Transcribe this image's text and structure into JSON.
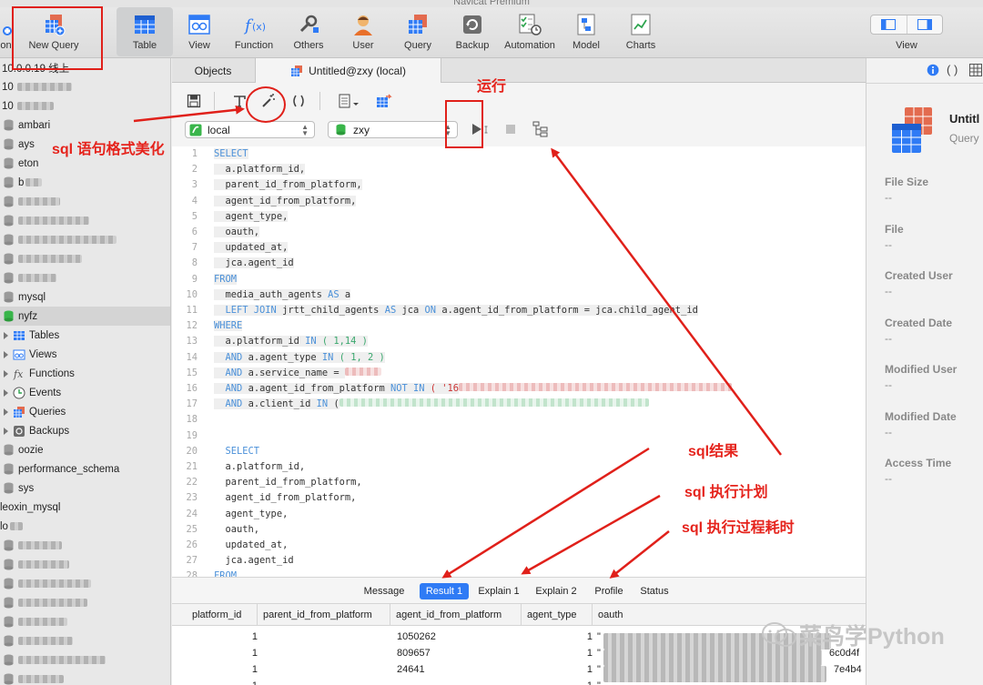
{
  "app": {
    "title": "Navicat Premium"
  },
  "toolbar": {
    "items": [
      {
        "label": "ction"
      },
      {
        "label": "New Query"
      },
      {
        "label": "Table"
      },
      {
        "label": "View"
      },
      {
        "label": "Function"
      },
      {
        "label": "Others"
      },
      {
        "label": "User"
      },
      {
        "label": "Query"
      },
      {
        "label": "Backup"
      },
      {
        "label": "Automation"
      },
      {
        "label": "Model"
      },
      {
        "label": "Charts"
      }
    ],
    "view_label": "View"
  },
  "sidebar": {
    "conn1": "10.0.0.19 线上",
    "conn2": "10",
    "conn3": "10",
    "dbs": [
      "ambari",
      "ays",
      "eton",
      "b",
      "mysql",
      "nyfz"
    ],
    "children": [
      "Tables",
      "Views",
      "Functions",
      "Events",
      "Queries",
      "Backups"
    ],
    "dbs_after": [
      "oozie",
      "performance_schema",
      "sys",
      "leoxin_mysql",
      "lo"
    ]
  },
  "tabs": {
    "objects": "Objects",
    "query": "Untitled@zxy (local)"
  },
  "query_toolbar": {
    "connection": "local",
    "database": "zxy"
  },
  "sql": {
    "select": "SELECT",
    "from": "FROM",
    "where": "WHERE",
    "c1": "a.platform_id,",
    "c2": "parent_id_from_platform,",
    "c3": "agent_id_from_platform,",
    "c4": "agent_type,",
    "c5": "oauth,",
    "c6": "updated_at,",
    "c7": "jca.agent_id",
    "f1a": "media_auth_agents",
    "as": "AS",
    "f1b": "a",
    "lj": "LEFT JOIN",
    "f2a": "jrtt_child_agents",
    "f2b": "jca",
    "on": "ON",
    "f2c": "a.agent_id_from_platform = jca.child_agent_id",
    "w1a": "a.platform_id",
    "in": "IN",
    "w1b": "( 1,14 )",
    "and": "AND",
    "w2a": "a.agent_type",
    "w2b": "( 1, 2 )",
    "w3a": "a.service_name =",
    "w4a": "a.agent_id_from_platform",
    "notin": "NOT IN",
    "w4b": "( '16",
    "w5a": "a.client_id",
    "w5b": "(",
    "line_numbers": [
      "1",
      "2",
      "3",
      "4",
      "5",
      "6",
      "7",
      "8",
      "9",
      "10",
      "11",
      "12",
      "13",
      "14",
      "15",
      "16",
      "17",
      "18",
      "19",
      "20",
      "21",
      "22",
      "23",
      "24",
      "25",
      "26",
      "27",
      "28"
    ]
  },
  "result_tabs": [
    "Message",
    "Result 1",
    "Explain 1",
    "Explain 2",
    "Profile",
    "Status"
  ],
  "grid": {
    "headers": [
      "platform_id",
      "parent_id_from_platform",
      "agent_id_from_platform",
      "agent_type",
      "oauth"
    ],
    "rows": [
      {
        "platform_id": "1",
        "agent_id": "1050262",
        "agent_type": "1",
        "oauth": "\"",
        "tail": ""
      },
      {
        "platform_id": "1",
        "agent_id": "809657",
        "agent_type": "1",
        "oauth": "\"",
        "tail": "6c0d4f"
      },
      {
        "platform_id": "1",
        "agent_id": "24641",
        "agent_type": "1",
        "oauth": "\"",
        "tail": "7e4b4"
      },
      {
        "platform_id": "1",
        "agent_id": "",
        "agent_type": "1",
        "oauth": "\"",
        "tail": ""
      }
    ]
  },
  "info": {
    "title": "Untitl",
    "subtitle": "Query",
    "fields": [
      {
        "label": "File Size",
        "value": "--"
      },
      {
        "label": "File",
        "value": "--"
      },
      {
        "label": "Created User",
        "value": "--"
      },
      {
        "label": "Created Date",
        "value": "--"
      },
      {
        "label": "Modified User",
        "value": "--"
      },
      {
        "label": "Modified Date",
        "value": "--"
      },
      {
        "label": "Access Time",
        "value": "--"
      }
    ]
  },
  "annotations": {
    "run": "运行",
    "beautify": "sql 语句格式美化",
    "result": "sql结果",
    "explain": "sql 执行计划",
    "profile": "sql 执行过程耗时"
  },
  "watermark": {
    "text": "菜鸟学Python"
  },
  "colors": {
    "accent": "#2f7bf5",
    "annotation": "#e5231c",
    "keyword": "#4a90d9"
  }
}
